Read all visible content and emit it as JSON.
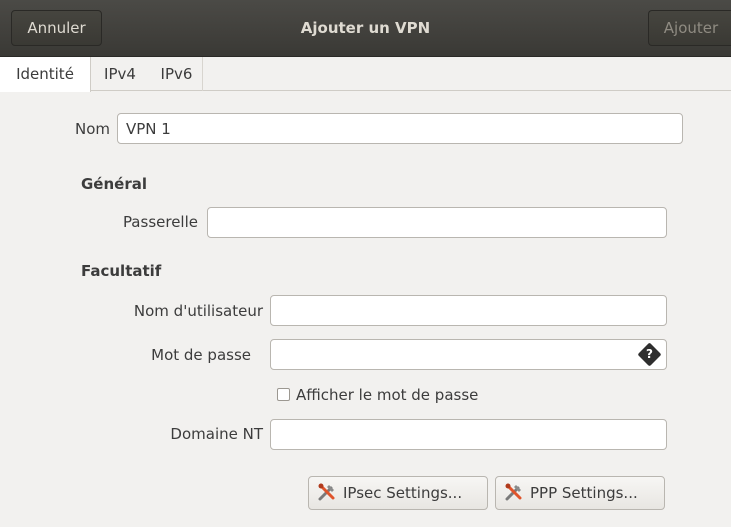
{
  "header": {
    "cancel_label": "Annuler",
    "title": "Ajouter un VPN",
    "add_label": "Ajouter"
  },
  "tabs": [
    {
      "label": "Identité",
      "active": true
    },
    {
      "label": "IPv4",
      "active": false
    },
    {
      "label": "IPv6",
      "active": false
    }
  ],
  "form": {
    "name_label": "Nom",
    "name_value": "VPN 1",
    "general_heading": "Général",
    "gateway_label": "Passerelle",
    "gateway_value": "",
    "optional_heading": "Facultatif",
    "username_label": "Nom d'utilisateur",
    "username_value": "",
    "password_label": "Mot de passe",
    "password_value": "",
    "show_password_label": "Afficher le mot de passe",
    "show_password_checked": false,
    "nt_domain_label": "Domaine NT",
    "nt_domain_value": "",
    "ipsec_button_label": "IPsec Settings...",
    "ppp_button_label": "PPP Settings..."
  },
  "colors": {
    "headerbar": "#3f3e3a",
    "background": "#f2f1ef",
    "tool_icon_accent": "#e0542b"
  },
  "icons": {
    "password_field": "password-menu-icon",
    "settings_buttons": "tools-icon"
  }
}
